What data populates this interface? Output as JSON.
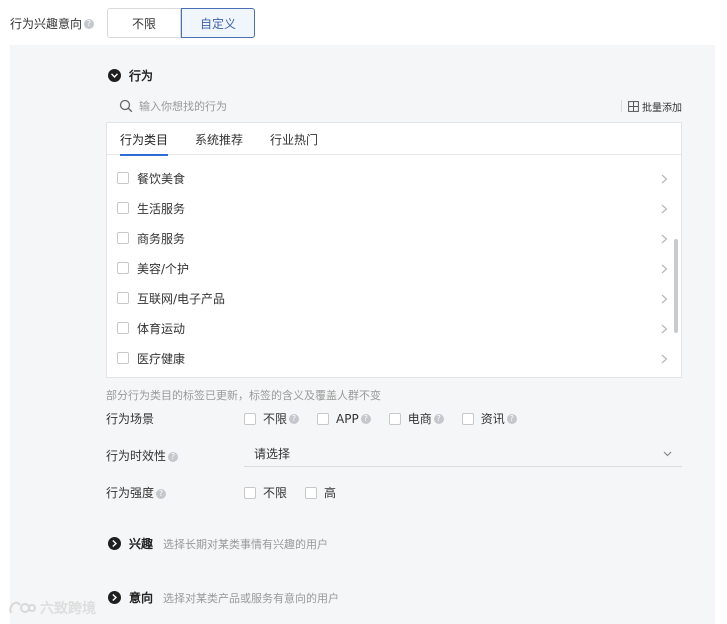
{
  "top": {
    "label": "行为兴趣意向",
    "options": [
      "不限",
      "自定义"
    ],
    "selected": "自定义"
  },
  "behavior": {
    "title": "行为",
    "search_placeholder": "输入你想找的行为",
    "bulk_add": "批量添加",
    "tabs": [
      "行为类目",
      "系统推荐",
      "行业热门"
    ],
    "active_tab": "行为类目",
    "items": [
      "餐饮美食",
      "生活服务",
      "商务服务",
      "美容/个护",
      "互联网/电子产品",
      "体育运动",
      "医疗健康"
    ],
    "note": "部分行为类目的标签已更新，标签的含义及覆盖人群不变"
  },
  "scene": {
    "label": "行为场景",
    "options": [
      "不限",
      "APP",
      "电商",
      "资讯"
    ]
  },
  "timeliness": {
    "label": "行为时效性",
    "placeholder": "请选择"
  },
  "intensity": {
    "label": "行为强度",
    "options": [
      "不限",
      "高"
    ]
  },
  "interest": {
    "title": "兴趣",
    "desc": "选择长期对某类事情有兴趣的用户"
  },
  "intent": {
    "title": "意向",
    "desc": "选择对某类产品或服务有意向的用户"
  },
  "watermark": "六致跨境",
  "colors": {
    "accent": "#2e6bd6",
    "panel_bg": "#f5f6f7",
    "active_segment_border": "#4a6fb5"
  }
}
